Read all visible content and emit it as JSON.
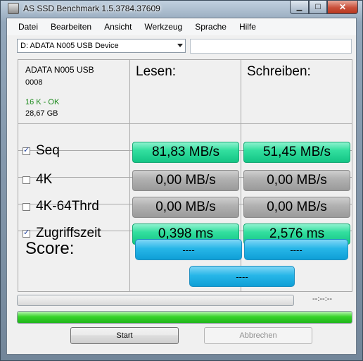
{
  "window": {
    "title": "AS SSD Benchmark 1.5.3784.37609"
  },
  "menu": [
    "Datei",
    "Bearbeiten",
    "Ansicht",
    "Werkzeug",
    "Sprache",
    "Hilfe"
  ],
  "drive_select": {
    "value": "D: ADATA N005 USB Device"
  },
  "drive_info": {
    "name": "ADATA N005 USB",
    "firmware": "0008",
    "alignment": "16 K - OK",
    "size": "28,67 GB"
  },
  "columns": {
    "read": "Lesen:",
    "write": "Schreiben:"
  },
  "rows": [
    {
      "label": "Seq",
      "checked": true,
      "read": "81,83 MB/s",
      "write": "51,45 MB/s",
      "status": "done"
    },
    {
      "label": "4K",
      "checked": false,
      "read": "0,00 MB/s",
      "write": "0,00 MB/s",
      "status": "skipped"
    },
    {
      "label": "4K-64Thrd",
      "checked": false,
      "read": "0,00 MB/s",
      "write": "0,00 MB/s",
      "status": "skipped"
    },
    {
      "label": "Zugriffszeit",
      "checked": true,
      "read": "0,398 ms",
      "write": "2,576 ms",
      "status": "done"
    }
  ],
  "score": {
    "label": "Score:",
    "read": "----",
    "write": "----",
    "total": "----"
  },
  "timer": "--:--:--",
  "progress_main_fraction": 1.0,
  "buttons": {
    "start": "Start",
    "cancel": "Abbrechen"
  },
  "colors": {
    "done": "#13c585",
    "skipped": "#9a9a9a",
    "score": "#27b6e8",
    "progress": "#37d42a"
  }
}
